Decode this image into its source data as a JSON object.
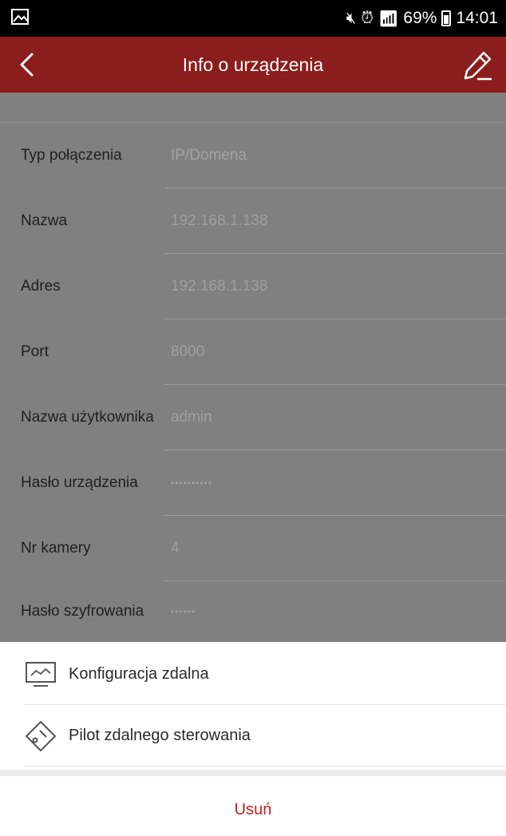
{
  "status_bar": {
    "battery": "69%",
    "time": "14:01"
  },
  "app_bar": {
    "title": "Info o urządzenia"
  },
  "fields": [
    {
      "label": "Typ połączenia",
      "value": "IP/Domena"
    },
    {
      "label": "Nazwa",
      "value": "192.168.1.138"
    },
    {
      "label": "Adres",
      "value": "192.168.1.138"
    },
    {
      "label": "Port",
      "value": "8000"
    },
    {
      "label": "Nazwa użytkownika",
      "value": "admin"
    },
    {
      "label": "Hasło urządzenia",
      "value": "••••••••••"
    },
    {
      "label": "Nr kamery",
      "value": "4"
    },
    {
      "label": "Hasło szyfrowania",
      "value": "••••••"
    }
  ],
  "sheet": {
    "items": [
      {
        "label": "Konfiguracja zdalna",
        "icon": "monitor-icon"
      },
      {
        "label": "Pilot zdalnego sterowania",
        "icon": "remote-control-icon"
      }
    ],
    "delete_label": "Usuń"
  },
  "colors": {
    "app_bar": "#8c1d1d",
    "overlay": "#808080",
    "delete": "#d0181e"
  }
}
